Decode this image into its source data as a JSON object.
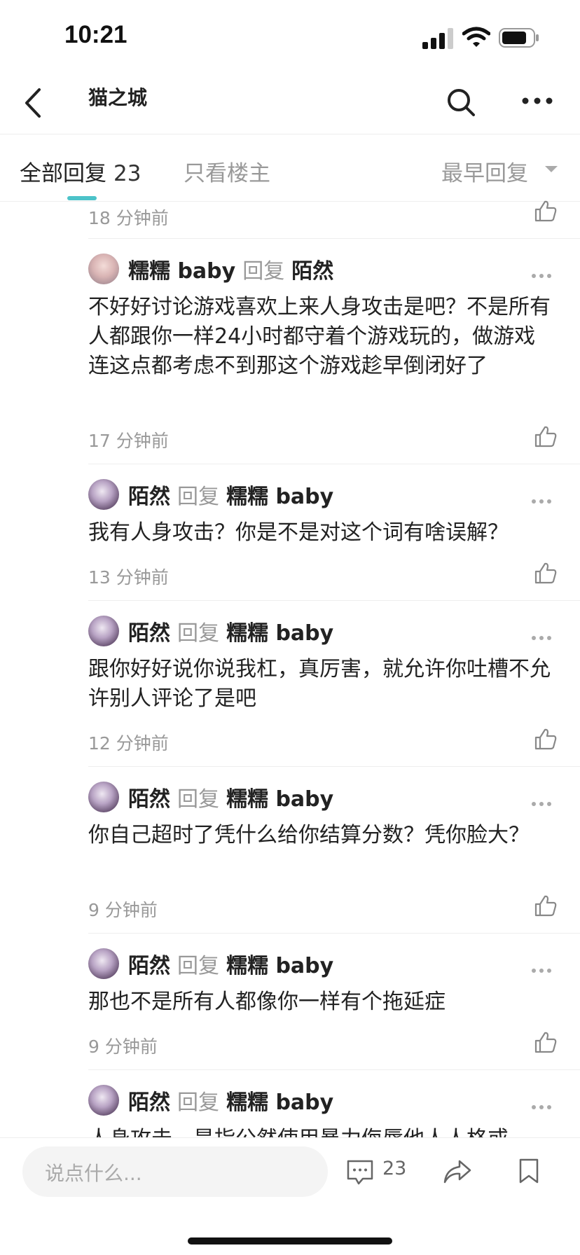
{
  "status": {
    "time": "10:21"
  },
  "nav": {
    "title": "猫之城"
  },
  "tabs": {
    "all_label": "全部回复",
    "all_count": "23",
    "owner_only": "只看楼主",
    "sort": "最早回复"
  },
  "top_time": "18 分钟前",
  "reply_word": "回复",
  "comments": [
    {
      "user": "糯糯 baby",
      "target": "陌然",
      "text": "不好好讨论游戏喜欢上来人身攻击是吧？不是所有人都跟你一样24小时都守着个游戏玩的，做游戏连这点都考虑不到那这个游戏趁早倒闭好了",
      "time": "17 分钟前"
    },
    {
      "user": "陌然",
      "target": "糯糯 baby",
      "text": "我有人身攻击？你是不是对这个词有啥误解？",
      "time": "13 分钟前"
    },
    {
      "user": "陌然",
      "target": "糯糯 baby",
      "text": "跟你好好说你说我杠，真厉害，就允许你吐槽不允许别人评论了是吧",
      "time": "12 分钟前"
    },
    {
      "user": "陌然",
      "target": "糯糯 baby",
      "text": "你自己超时了凭什么给你结算分数？凭你脸大？",
      "time": "9 分钟前"
    },
    {
      "user": "陌然",
      "target": "糯糯 baby",
      "text": "那也不是所有人都像你一样有个拖延症",
      "time": "9 分钟前"
    },
    {
      "user": "陌然",
      "target": "糯糯 baby",
      "text": "人身攻击，是指公然使用暴力侮辱他人人格或"
    }
  ],
  "bottom": {
    "placeholder": "说点什么...",
    "comment_count": "23"
  },
  "colors": {
    "accent": "#4cc3c9"
  },
  "icons": [
    "back-icon",
    "search-icon",
    "more-icon",
    "like-icon",
    "comment-icon",
    "share-icon",
    "bookmark-icon"
  ]
}
